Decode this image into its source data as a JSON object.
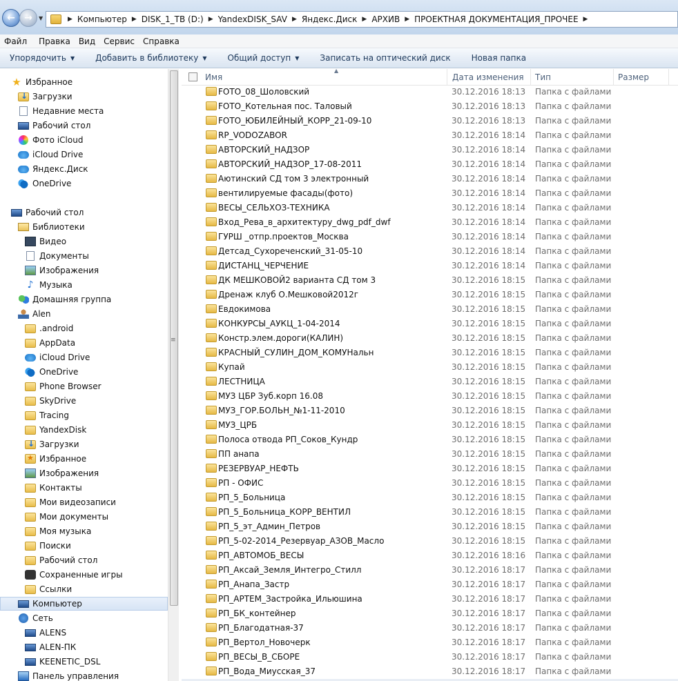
{
  "address": {
    "crumbs": [
      "Компьютер",
      "DISK_1_TB (D:)",
      "YandexDISK_SAV",
      "Яндекс.Диск",
      "АРХИВ",
      "ПРОЕКТНАЯ ДОКУМЕНТАЦИЯ_ПРОЧЕЕ"
    ]
  },
  "menu": [
    "Файл",
    "Правка",
    "Вид",
    "Сервис",
    "Справка"
  ],
  "toolbar": {
    "organize": "Упорядочить",
    "add_library": "Добавить в библиотеку",
    "share": "Общий доступ",
    "burn": "Записать на оптический диск",
    "new_folder": "Новая папка"
  },
  "nav": [
    {
      "label": "Избранное",
      "icon": "star",
      "indent": 0
    },
    {
      "label": "Загрузки",
      "icon": "dl",
      "indent": 1
    },
    {
      "label": "Недавние места",
      "icon": "doc",
      "indent": 1
    },
    {
      "label": "Рабочий стол",
      "icon": "pc",
      "indent": 1
    },
    {
      "label": "Фото iCloud",
      "icon": "photo",
      "indent": 1
    },
    {
      "label": "iCloud Drive",
      "icon": "cloud",
      "indent": 1
    },
    {
      "label": "Яндекс.Диск",
      "icon": "cloud",
      "indent": 1
    },
    {
      "label": "OneDrive",
      "icon": "onedrive",
      "indent": 1
    },
    {
      "label": "",
      "icon": "",
      "indent": 0
    },
    {
      "label": "Рабочий стол",
      "icon": "pc",
      "indent": 0
    },
    {
      "label": "Библиотеки",
      "icon": "lib",
      "indent": 1
    },
    {
      "label": "Видео",
      "icon": "video",
      "indent": 2
    },
    {
      "label": "Документы",
      "icon": "doc",
      "indent": 2
    },
    {
      "label": "Изображения",
      "icon": "img",
      "indent": 2
    },
    {
      "label": "Музыка",
      "icon": "music",
      "indent": 2
    },
    {
      "label": "Домашняя группа",
      "icon": "group",
      "indent": 1
    },
    {
      "label": "Alen",
      "icon": "user",
      "indent": 1
    },
    {
      "label": ".android",
      "icon": "folder",
      "indent": 2
    },
    {
      "label": "AppData",
      "icon": "folder",
      "indent": 2
    },
    {
      "label": "iCloud Drive",
      "icon": "cloud",
      "indent": 2
    },
    {
      "label": "OneDrive",
      "icon": "onedrive",
      "indent": 2
    },
    {
      "label": "Phone Browser",
      "icon": "folder",
      "indent": 2
    },
    {
      "label": "SkyDrive",
      "icon": "folder",
      "indent": 2
    },
    {
      "label": "Tracing",
      "icon": "folder",
      "indent": 2
    },
    {
      "label": "YandexDisk",
      "icon": "folder",
      "indent": 2
    },
    {
      "label": "Загрузки",
      "icon": "dl",
      "indent": 2
    },
    {
      "label": "Избранное",
      "icon": "fav",
      "indent": 2
    },
    {
      "label": "Изображения",
      "icon": "img",
      "indent": 2
    },
    {
      "label": "Контакты",
      "icon": "folder",
      "indent": 2
    },
    {
      "label": "Мои видеозаписи",
      "icon": "folder",
      "indent": 2
    },
    {
      "label": "Мои документы",
      "icon": "folder",
      "indent": 2
    },
    {
      "label": "Моя музыка",
      "icon": "folder",
      "indent": 2
    },
    {
      "label": "Поиски",
      "icon": "folder",
      "indent": 2
    },
    {
      "label": "Рабочий стол",
      "icon": "folder",
      "indent": 2
    },
    {
      "label": "Сохраненные игры",
      "icon": "game",
      "indent": 2
    },
    {
      "label": "Ссылки",
      "icon": "folder",
      "indent": 2
    },
    {
      "label": "Компьютер",
      "icon": "pc",
      "indent": 1,
      "selected": true
    },
    {
      "label": "Сеть",
      "icon": "net",
      "indent": 1
    },
    {
      "label": "ALENS",
      "icon": "pc",
      "indent": 2
    },
    {
      "label": "ALEN-ПК",
      "icon": "pc",
      "indent": 2
    },
    {
      "label": "KEENETIC_DSL",
      "icon": "pc",
      "indent": 2
    },
    {
      "label": "Панель управления",
      "icon": "panel",
      "indent": 1
    }
  ],
  "columns": {
    "name": "Имя",
    "date": "Дата изменения",
    "type": "Тип",
    "size": "Размер"
  },
  "files": [
    {
      "name": "FOTO_08_Шоловский",
      "date": "30.12.2016 18:13",
      "type": "Папка с файлами"
    },
    {
      "name": "FOTO_Котельная пос. Таловый",
      "date": "30.12.2016 18:13",
      "type": "Папка с файлами"
    },
    {
      "name": "FOTO_ЮБИЛЕЙНЫЙ_КОРР_21-09-10",
      "date": "30.12.2016 18:13",
      "type": "Папка с файлами"
    },
    {
      "name": "RP_VODOZABOR",
      "date": "30.12.2016 18:14",
      "type": "Папка с файлами"
    },
    {
      "name": "АВТОРСКИЙ_НАДЗОР",
      "date": "30.12.2016 18:14",
      "type": "Папка с файлами"
    },
    {
      "name": "АВТОРСКИЙ_НАДЗОР_17-08-2011",
      "date": "30.12.2016 18:14",
      "type": "Папка с файлами"
    },
    {
      "name": "Аютинский СД том 3 электронный",
      "date": "30.12.2016 18:14",
      "type": "Папка с файлами"
    },
    {
      "name": "вентилируемые фасады(фото)",
      "date": "30.12.2016 18:14",
      "type": "Папка с файлами"
    },
    {
      "name": "ВЕСЫ_СЕЛЬХОЗ-ТЕХНИКА",
      "date": "30.12.2016 18:14",
      "type": "Папка с файлами"
    },
    {
      "name": "Вход_Рева_в_архитектуру_dwg_pdf_dwf",
      "date": "30.12.2016 18:14",
      "type": "Папка с файлами"
    },
    {
      "name": "ГУРШ _отпр.проектов_Москва",
      "date": "30.12.2016 18:14",
      "type": "Папка с файлами"
    },
    {
      "name": "Детсад_Сухореченский_31-05-10",
      "date": "30.12.2016 18:14",
      "type": "Папка с файлами"
    },
    {
      "name": "ДИСТАНЦ_ЧЕРЧЕНИЕ",
      "date": "30.12.2016 18:14",
      "type": "Папка с файлами"
    },
    {
      "name": "ДК МЕШКОВОЙ2 варианта  СД том 3",
      "date": "30.12.2016 18:15",
      "type": "Папка с файлами"
    },
    {
      "name": "Дренаж клуб О.Мешковой2012г",
      "date": "30.12.2016 18:15",
      "type": "Папка с файлами"
    },
    {
      "name": "Евдокимова",
      "date": "30.12.2016 18:15",
      "type": "Папка с файлами"
    },
    {
      "name": "КОНКУРСЫ_АУКЦ_1-04-2014",
      "date": "30.12.2016 18:15",
      "type": "Папка с файлами"
    },
    {
      "name": "Констр.элем.дороги(КАЛИН)",
      "date": "30.12.2016 18:15",
      "type": "Папка с файлами"
    },
    {
      "name": "КРАСНЫЙ_СУЛИН_ДОМ_КОМУНальн",
      "date": "30.12.2016 18:15",
      "type": "Папка с файлами"
    },
    {
      "name": "Купай",
      "date": "30.12.2016 18:15",
      "type": "Папка с файлами"
    },
    {
      "name": "ЛЕСТНИЦА",
      "date": "30.12.2016 18:15",
      "type": "Папка с файлами"
    },
    {
      "name": "МУЗ ЦБР Зуб.корп 16.08",
      "date": "30.12.2016 18:15",
      "type": "Папка с файлами"
    },
    {
      "name": "МУЗ_ГОР.БОЛЬН_№1-11-2010",
      "date": "30.12.2016 18:15",
      "type": "Папка с файлами"
    },
    {
      "name": "МУЗ_ЦРБ",
      "date": "30.12.2016 18:15",
      "type": "Папка с файлами"
    },
    {
      "name": "Полоса отвода РП_Соков_Кундр",
      "date": "30.12.2016 18:15",
      "type": "Папка с файлами"
    },
    {
      "name": "ПП анапа",
      "date": "30.12.2016 18:15",
      "type": "Папка с файлами"
    },
    {
      "name": "РЕЗЕРВУАР_НЕФТЬ",
      "date": "30.12.2016 18:15",
      "type": "Папка с файлами"
    },
    {
      "name": "РП - ОФИС",
      "date": "30.12.2016 18:15",
      "type": "Папка с файлами"
    },
    {
      "name": "РП_5_Больница",
      "date": "30.12.2016 18:15",
      "type": "Папка с файлами"
    },
    {
      "name": "РП_5_Больница_КОРР_ВЕНТИЛ",
      "date": "30.12.2016 18:15",
      "type": "Папка с файлами"
    },
    {
      "name": "РП_5_эт_Админ_Петров",
      "date": "30.12.2016 18:15",
      "type": "Папка с файлами"
    },
    {
      "name": "РП_5-02-2014_Резервуар_АЗОВ_Масло",
      "date": "30.12.2016 18:15",
      "type": "Папка с файлами"
    },
    {
      "name": "РП_АВТОМОБ_ВЕСЫ",
      "date": "30.12.2016 18:16",
      "type": "Папка с файлами"
    },
    {
      "name": "РП_Аксай_Земля_Интегро_Стилл",
      "date": "30.12.2016 18:17",
      "type": "Папка с файлами"
    },
    {
      "name": "РП_Анапа_Застр",
      "date": "30.12.2016 18:17",
      "type": "Папка с файлами"
    },
    {
      "name": "РП_АРТЕМ_Застройка_Ильюшина",
      "date": "30.12.2016 18:17",
      "type": "Папка с файлами"
    },
    {
      "name": "РП_БК_контейнер",
      "date": "30.12.2016 18:17",
      "type": "Папка с файлами"
    },
    {
      "name": "РП_Благодатная-37",
      "date": "30.12.2016 18:17",
      "type": "Папка с файлами"
    },
    {
      "name": "РП_Вертол_Новочерк",
      "date": "30.12.2016 18:17",
      "type": "Папка с файлами"
    },
    {
      "name": "РП_ВЕСЫ_В_СБОРЕ",
      "date": "30.12.2016 18:17",
      "type": "Папка с файлами"
    },
    {
      "name": "РП_Вода_Миусская_37",
      "date": "30.12.2016 18:17",
      "type": "Папка с файлами"
    }
  ]
}
